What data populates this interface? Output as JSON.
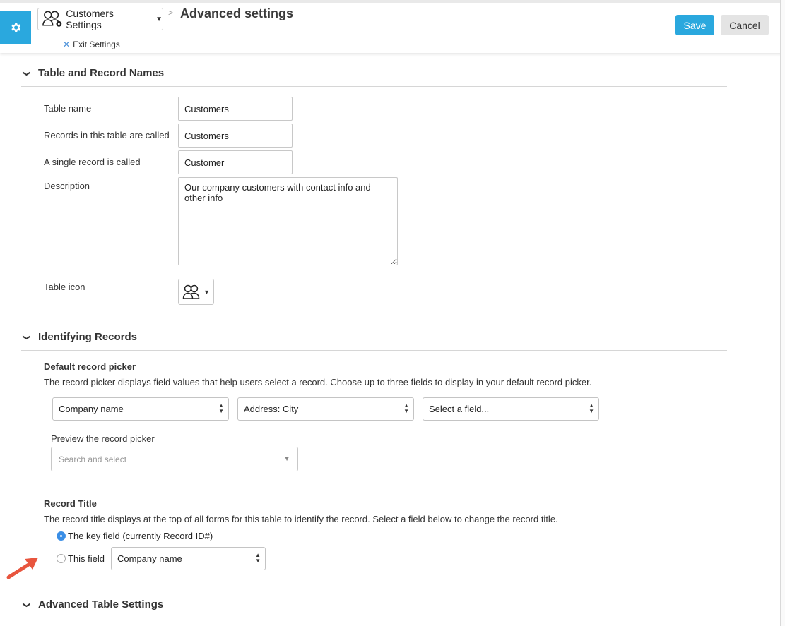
{
  "header": {
    "breadcrumb_label": "Customers Settings",
    "page_title": "Advanced settings",
    "exit_label": "Exit Settings",
    "save_label": "Save",
    "cancel_label": "Cancel"
  },
  "sections": {
    "names": {
      "title": "Table and Record Names",
      "table_name_label": "Table name",
      "table_name_value": "Customers",
      "records_called_label": "Records in this table are called",
      "records_called_value": "Customers",
      "single_called_label": "A single record is called",
      "single_called_value": "Customer",
      "description_label": "Description",
      "description_value": "Our company customers with contact info and other info",
      "table_icon_label": "Table icon"
    },
    "identifying": {
      "title": "Identifying Records",
      "picker_heading": "Default record picker",
      "picker_desc": "The record picker displays field values that help users select a record. Choose up to three fields to display in your default record picker.",
      "field1": "Company name",
      "field2": "Address: City",
      "field3": "Select a field...",
      "preview_label": "Preview the record picker",
      "preview_placeholder": "Search and select",
      "title_heading": "Record Title",
      "title_desc": "The record title displays at the top of all forms for this table to identify the record. Select a field below to change the record title.",
      "radio_key_label": "The key field (currently Record ID#)",
      "radio_field_label": "This field",
      "title_field_value": "Company name"
    },
    "advanced": {
      "title": "Advanced Table Settings"
    }
  },
  "colors": {
    "accent": "#2aa8de",
    "radio_selected": "#3a8ee6",
    "annotation_arrow": "#e8553e"
  }
}
